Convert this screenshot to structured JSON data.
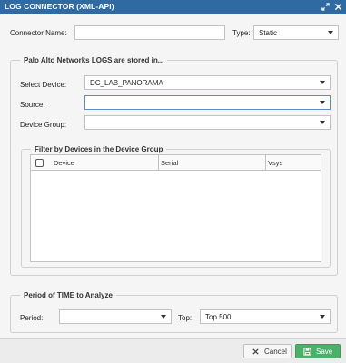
{
  "window": {
    "title": "LOG CONNECTOR (XML-API)",
    "icons": [
      "expand-icon",
      "close-icon"
    ]
  },
  "connector": {
    "name_label": "Connector Name:",
    "name_value": "",
    "type_label": "Type:",
    "type_value": "Static"
  },
  "logs_section": {
    "legend": "Palo Alto Networks LOGS are stored in...",
    "select_device_label": "Select Device:",
    "select_device_value": "DC_LAB_PANORAMA",
    "source_label": "Source:",
    "source_value": "",
    "device_group_label": "Device Group:",
    "device_group_value": ""
  },
  "filter_section": {
    "legend": "Filter by Devices in the Device Group",
    "columns": [
      "Device",
      "Serial",
      "Vsys"
    ],
    "rows": []
  },
  "time_section": {
    "legend": "Period of TIME to Analyze",
    "period_label": "Period:",
    "period_value": "",
    "top_label": "Top:",
    "top_value": "Top 500"
  },
  "footer": {
    "cancel_label": "Cancel",
    "save_label": "Save"
  },
  "colors": {
    "titlebar": "#2f6aa3",
    "save_button": "#4caf6a"
  }
}
